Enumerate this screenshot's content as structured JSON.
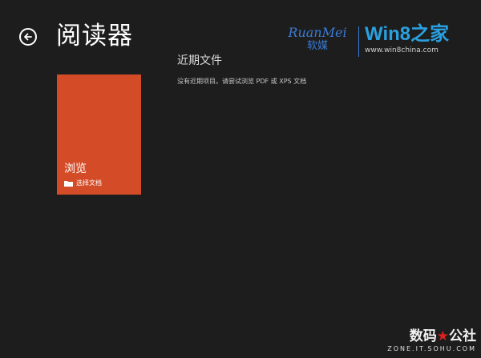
{
  "header": {
    "title": "阅读器",
    "back_icon": "back-arrow-icon"
  },
  "recent": {
    "section_title": "近期文件",
    "empty_message": "没有近期项目。请尝试浏览 PDF 或 XPS 文档"
  },
  "browse_tile": {
    "title": "浏览",
    "subtitle": "选择文档",
    "icon": "folder-icon",
    "color": "#d44b27"
  },
  "watermarks": {
    "ruanmei_en": "RuanMei",
    "ruanmei_cn": "软媒",
    "win8": "Win8之家",
    "win8_url": "www.win8china.com",
    "sohu_cn_left": "数码",
    "sohu_cn_right": "公社",
    "sohu_en": "ZONE.IT.SOHU.COM"
  },
  "colors": {
    "background": "#1d1d1d",
    "accent": "#d44b27",
    "logo_blue": "#3a7bd5"
  }
}
